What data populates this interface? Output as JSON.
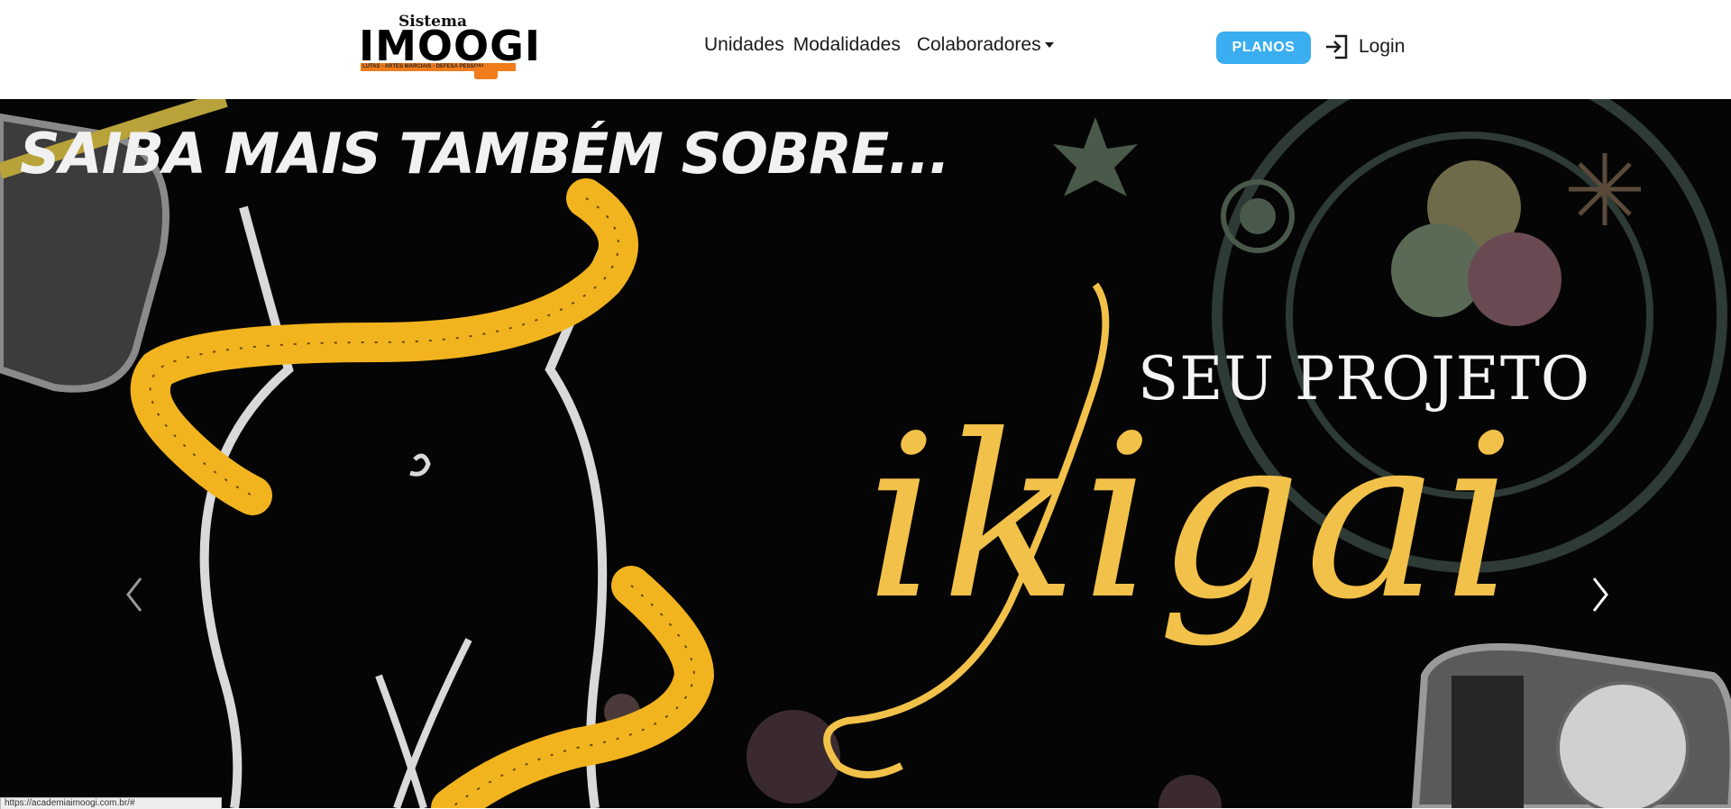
{
  "logo": {
    "top_text": "Sistema",
    "main_text": "IMOOGI",
    "sub_text": "LUTAS - ARTES MARCIAIS - DEFESA PESSOAL"
  },
  "nav": {
    "items": [
      {
        "label": "Unidades"
      },
      {
        "label": "Modalidades"
      },
      {
        "label": "Colaboradores"
      }
    ],
    "planos_label": "PLANOS",
    "login_label": "Login"
  },
  "hero": {
    "title": "SAIBA MAIS TAMBÉM SOBRE...",
    "subtitle": "SEU PROJETO",
    "script": "ikigai"
  },
  "status_bar": {
    "url": "https://academiaimoogi.com.br/#"
  },
  "colors": {
    "accent": "#3aaef0",
    "brand_orange": "#f07c1b",
    "hero_bg": "#050505",
    "tape_yellow": "#f2b41e",
    "script_gold": "#f2c14a"
  }
}
